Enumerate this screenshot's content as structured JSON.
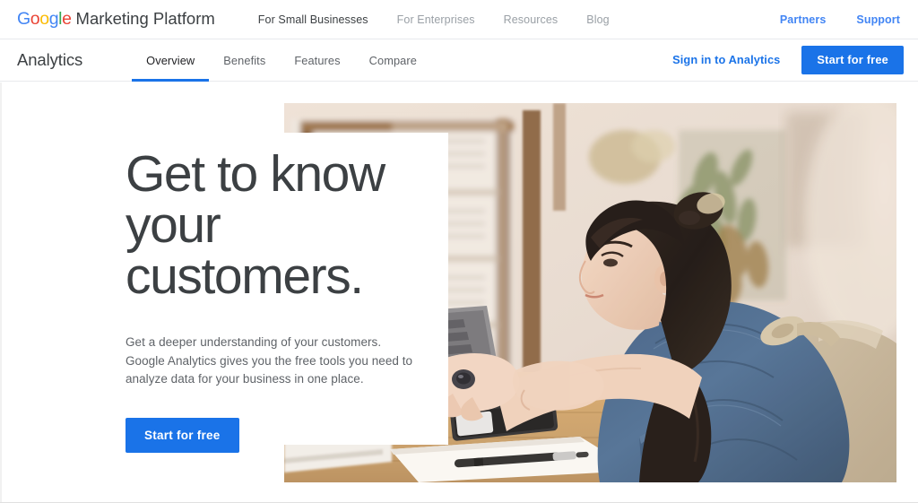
{
  "colors": {
    "brand_blue": "#1a73e8",
    "link_blue": "#4285f4",
    "text_dark": "#3c4043",
    "text_muted": "#9aa0a6",
    "text_body": "#5f6368",
    "border": "#e8eaed",
    "google_blue": "#4285f4",
    "google_red": "#ea4335",
    "google_yellow": "#fbbc05",
    "google_green": "#34a853"
  },
  "top_bar": {
    "brand": {
      "google_letters": [
        "G",
        "o",
        "o",
        "g",
        "l",
        "e"
      ],
      "suffix": "Marketing Platform"
    },
    "nav": [
      {
        "label": "For Small Businesses",
        "active": true
      },
      {
        "label": "For Enterprises",
        "active": false
      },
      {
        "label": "Resources",
        "active": false
      },
      {
        "label": "Blog",
        "active": false
      }
    ],
    "right_links": [
      {
        "label": "Partners"
      },
      {
        "label": "Support"
      }
    ]
  },
  "product_bar": {
    "title": "Analytics",
    "tabs": [
      {
        "label": "Overview",
        "active": true
      },
      {
        "label": "Benefits",
        "active": false
      },
      {
        "label": "Features",
        "active": false
      },
      {
        "label": "Compare",
        "active": false
      }
    ],
    "signin_label": "Sign in to Analytics",
    "cta_label": "Start for free"
  },
  "hero": {
    "headline_line1": "Get to know",
    "headline_line2": "your",
    "headline_line3": "customers.",
    "subtext": "Get a deeper understanding of your customers. Google Analytics gives you the free tools you need to analyze data for your business in one place.",
    "cta_label": "Start for free",
    "photo_alt": "Woman in denim jacket working on a laptop at a wooden desk in a shop"
  }
}
